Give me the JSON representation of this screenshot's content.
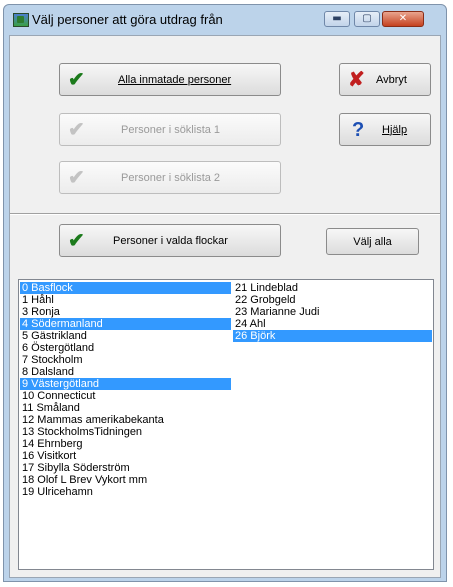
{
  "window": {
    "title": "Välj personer att göra utdrag från",
    "controls": {
      "minimize": "▬",
      "maximize": "▢",
      "close": "✕"
    }
  },
  "buttons": {
    "all_persons": "Alla inmatade personer",
    "cancel": "Avbryt",
    "search_list_1": "Personer i söklista 1",
    "help": "Hjälp",
    "search_list_2": "Personer i söklista 2",
    "selected_flocks": "Personer i valda flockar",
    "select_all": "Välj alla"
  },
  "icons": {
    "check": "✔",
    "x": "✘",
    "question": "?"
  },
  "list": {
    "column1": [
      {
        "label": "0 Basflock",
        "selected": true
      },
      {
        "label": "1 Håhl",
        "selected": false
      },
      {
        "label": "3 Ronja",
        "selected": false
      },
      {
        "label": "4 Södermanland",
        "selected": true
      },
      {
        "label": "5 Gästrikland",
        "selected": false
      },
      {
        "label": "6 Östergötland",
        "selected": false
      },
      {
        "label": "7 Stockholm",
        "selected": false
      },
      {
        "label": "8 Dalsland",
        "selected": false
      },
      {
        "label": "9 Västergötland",
        "selected": true
      },
      {
        "label": "10 Connecticut",
        "selected": false
      },
      {
        "label": "11 Småland",
        "selected": false
      },
      {
        "label": "12 Mammas amerikabekanta",
        "selected": false
      },
      {
        "label": "13 StockholmsTidningen",
        "selected": false
      },
      {
        "label": "14 Ehrnberg",
        "selected": false
      },
      {
        "label": "16 Visitkort",
        "selected": false
      },
      {
        "label": "17 Sibylla Söderström",
        "selected": false
      },
      {
        "label": "18 Olof L Brev Vykort mm",
        "selected": false
      },
      {
        "label": "19 Ulricehamn",
        "selected": false
      }
    ],
    "column2": [
      {
        "label": "21 Lindeblad",
        "selected": false
      },
      {
        "label": "22 Grobgeld",
        "selected": false
      },
      {
        "label": "23 Marianne Judi",
        "selected": false
      },
      {
        "label": "24 Ahl",
        "selected": false
      },
      {
        "label": "26 Björk",
        "selected": true
      }
    ]
  },
  "colors": {
    "selection": "#3399ff",
    "titlebar": "#bcd3ea"
  }
}
